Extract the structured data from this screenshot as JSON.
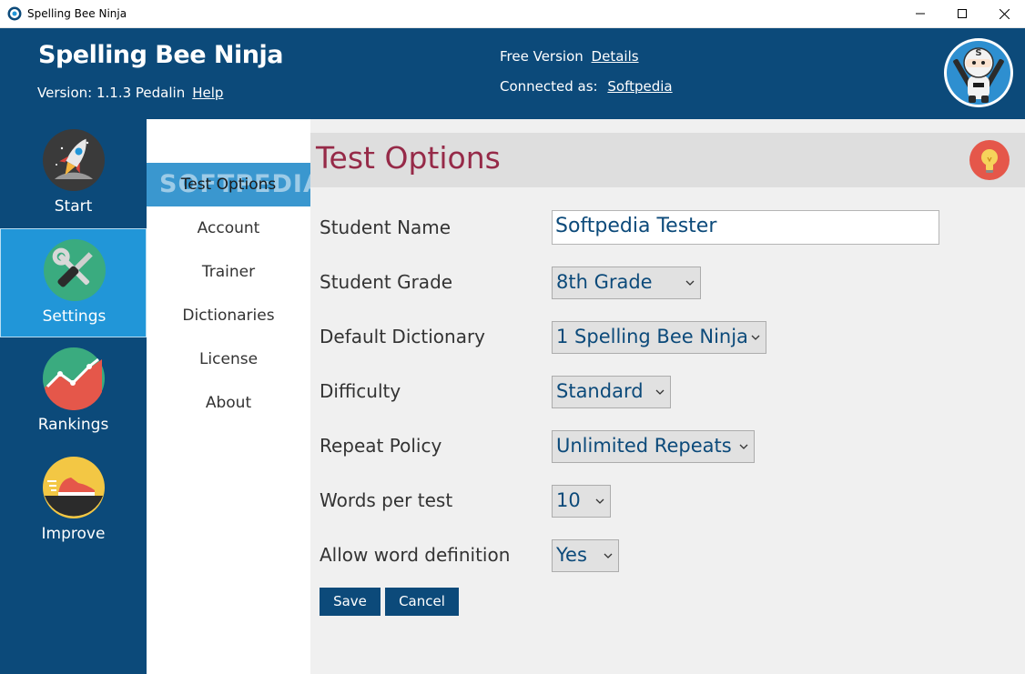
{
  "window": {
    "title": "Spelling Bee Ninja"
  },
  "header": {
    "brand": "Spelling Bee Ninja",
    "version_text": "Version: 1.1.3 Pedalin",
    "help_link": "Help",
    "free_version_text": "Free Version",
    "details_link": "Details",
    "connected_text": "Connected as:",
    "user_link": "Softpedia"
  },
  "sidebar": {
    "items": [
      {
        "label": "Start",
        "icon": "rocket-icon"
      },
      {
        "label": "Settings",
        "icon": "tools-icon",
        "active": true
      },
      {
        "label": "Rankings",
        "icon": "chart-icon"
      },
      {
        "label": "Improve",
        "icon": "sneaker-icon"
      }
    ]
  },
  "subnav": {
    "items": [
      {
        "label": "Test Options",
        "active": true
      },
      {
        "label": "Account"
      },
      {
        "label": "Trainer"
      },
      {
        "label": "Dictionaries"
      },
      {
        "label": "License"
      },
      {
        "label": "About"
      }
    ],
    "watermark": "SOFTPEDIA"
  },
  "main": {
    "title": "Test Options",
    "fields": {
      "student_name": {
        "label": "Student Name",
        "value": "Softpedia Tester"
      },
      "student_grade": {
        "label": "Student Grade",
        "value": "8th Grade"
      },
      "default_dictionary": {
        "label": "Default Dictionary",
        "value": "1 Spelling Bee Ninja"
      },
      "difficulty": {
        "label": "Difficulty",
        "value": "Standard"
      },
      "repeat_policy": {
        "label": "Repeat Policy",
        "value": "Unlimited Repeats"
      },
      "words_per_test": {
        "label": "Words per test",
        "value": "10"
      },
      "allow_word_definition": {
        "label": "Allow word definition",
        "value": "Yes"
      }
    },
    "save_label": "Save",
    "cancel_label": "Cancel"
  },
  "colors": {
    "header_bg": "#0c4a7a",
    "active_nav": "#2196d8",
    "title_color": "#962a48",
    "content_bg": "#f0f0f0"
  }
}
